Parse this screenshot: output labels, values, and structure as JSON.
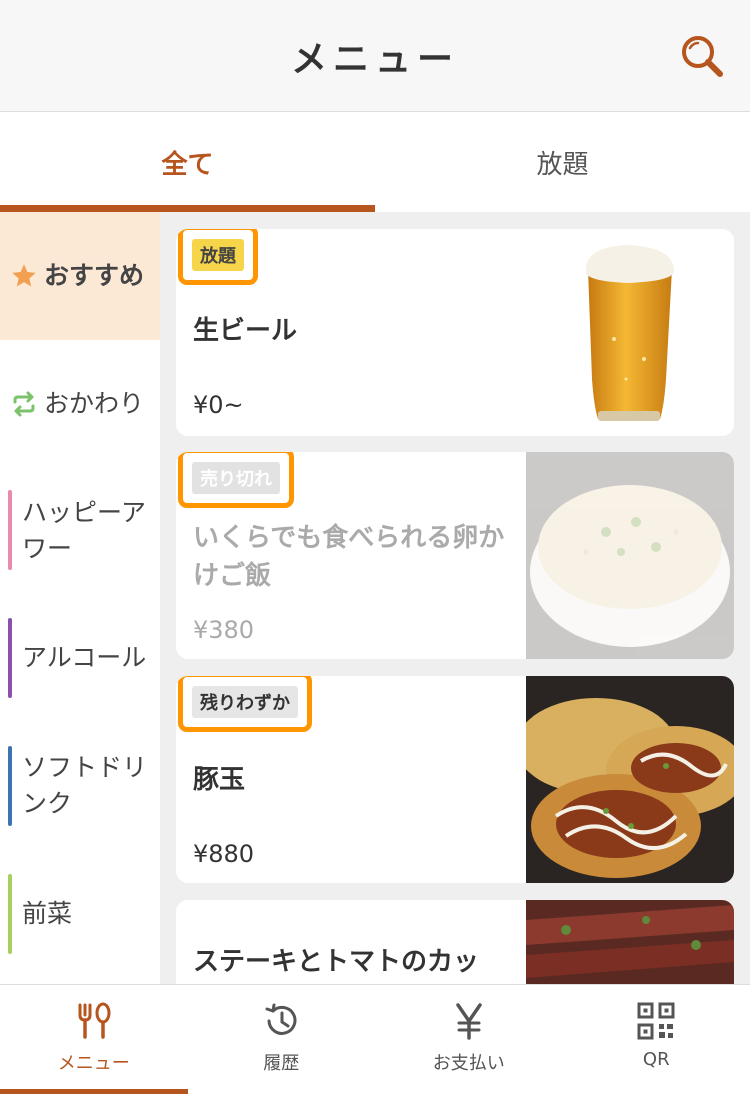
{
  "header": {
    "title": "メニュー"
  },
  "tabs": [
    {
      "label": "全て",
      "active": true
    },
    {
      "label": "放題",
      "active": false
    }
  ],
  "sidebar": {
    "items": [
      {
        "label": "おすすめ",
        "icon": "star-icon",
        "color": "#f0a050"
      },
      {
        "label": "おかわり",
        "icon": "refresh-icon",
        "color": "#7cc26b"
      },
      {
        "label": "ハッピーアワー",
        "color": "#e68ab0"
      },
      {
        "label": "アルコール",
        "color": "#8b4fb0"
      },
      {
        "label": "ソフトドリンク",
        "color": "#3d73b0"
      },
      {
        "label": "前菜",
        "color": "#a8d060"
      }
    ]
  },
  "menu_items": [
    {
      "badge": "放題",
      "name": "生ビール",
      "price": "¥0~",
      "state": "available",
      "image": "beer-glass-image"
    },
    {
      "badge": "売り切れ",
      "name": "いくらでも食べられる卵かけご飯",
      "price": "¥380",
      "state": "sold-out",
      "image": "egg-rice-bowl-image"
    },
    {
      "badge": "残りわずか",
      "name": "豚玉",
      "price": "¥880",
      "state": "few-left",
      "image": "okonomiyaki-image"
    },
    {
      "name": "ステーキとトマトのカッ",
      "state": "available",
      "image": "steak-image"
    }
  ],
  "bottom_nav": [
    {
      "label": "メニュー",
      "icon": "fork-spoon-icon",
      "active": true
    },
    {
      "label": "履歴",
      "icon": "history-icon",
      "active": false
    },
    {
      "label": "お支払い",
      "icon": "yen-icon",
      "active": false
    },
    {
      "label": "QR",
      "icon": "qr-code-icon",
      "active": false
    }
  ],
  "colors": {
    "accent": "#b6561e",
    "highlight": "#ff9500",
    "plan_badge": "#f7d54a"
  }
}
